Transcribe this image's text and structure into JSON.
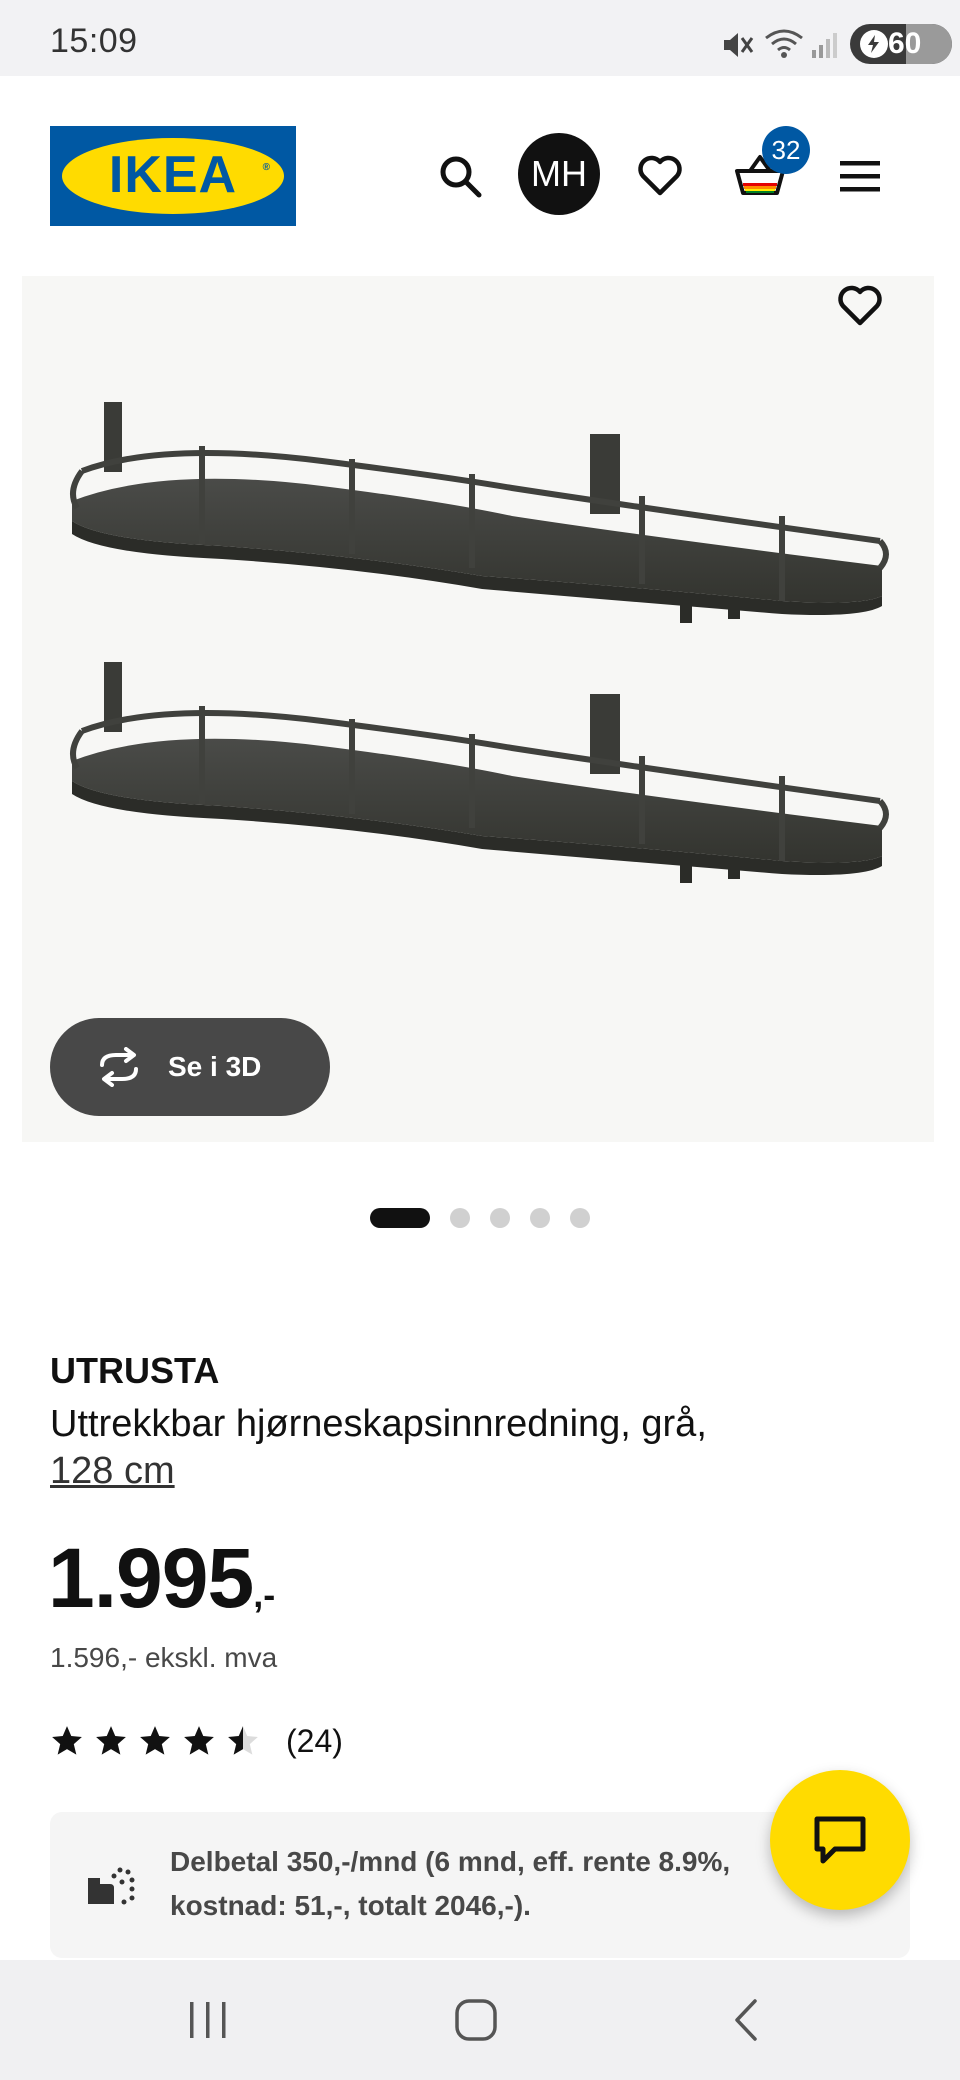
{
  "status_bar": {
    "time": "15:09",
    "battery_percent": "60"
  },
  "header": {
    "logo_text": "IKEA",
    "avatar_initials": "MH",
    "cart_count": "32"
  },
  "gallery": {
    "see_3d_label": "Se i 3D",
    "slide_count": 5,
    "active_slide": 1
  },
  "product": {
    "brand": "UTRUSTA",
    "description": "Uttrekkbar hjørneskapsinnredning, grå,",
    "size": "128 cm",
    "price_main": "1.995",
    "price_suffix": ",-",
    "price_ex_vat": "1.596,- ekskl. mva",
    "rating": 4.5,
    "review_count": "(24)"
  },
  "installment": {
    "text": "Delbetal 350,-/mnd (6 mnd, eff. rente 8.9%, kostnad: 51,-, totalt 2046,-)."
  },
  "colors": {
    "ikea_blue": "#0058a3",
    "ikea_yellow": "#ffdb00",
    "dark_button": "#484848"
  },
  "icons": [
    "search-icon",
    "heart-icon",
    "basket-icon",
    "menu-icon",
    "rotate-3d-icon",
    "star-icon",
    "installment-icon",
    "chat-icon",
    "recent-apps-icon",
    "home-icon",
    "back-icon"
  ]
}
